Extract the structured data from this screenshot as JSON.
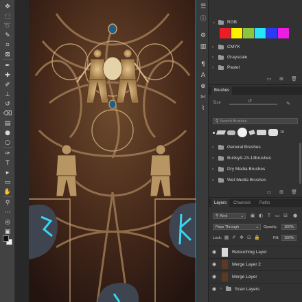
{
  "toolbar": {
    "tools": [
      {
        "icon": "move-icon",
        "glyph": "✥"
      },
      {
        "icon": "marquee-icon",
        "glyph": "⬚"
      },
      {
        "icon": "lasso-icon",
        "glyph": "➰"
      },
      {
        "icon": "quick-select-icon",
        "glyph": "✎"
      },
      {
        "icon": "crop-icon",
        "glyph": "⌗"
      },
      {
        "icon": "frame-icon",
        "glyph": "⊠"
      },
      {
        "icon": "eyedropper-icon",
        "glyph": "✒"
      },
      {
        "icon": "spot-heal-icon",
        "glyph": "✚"
      },
      {
        "icon": "brush-icon",
        "glyph": "✐"
      },
      {
        "icon": "clone-stamp-icon",
        "glyph": "⊥"
      },
      {
        "icon": "history-brush-icon",
        "glyph": "↺"
      },
      {
        "icon": "eraser-icon",
        "glyph": "⌫"
      },
      {
        "icon": "gradient-icon",
        "glyph": "▤"
      },
      {
        "icon": "blur-icon",
        "glyph": "●"
      },
      {
        "icon": "dodge-icon",
        "glyph": "○"
      },
      {
        "icon": "pen-icon",
        "glyph": "✑"
      },
      {
        "icon": "type-icon",
        "glyph": "T"
      },
      {
        "icon": "path-select-icon",
        "glyph": "▸"
      },
      {
        "icon": "rectangle-icon",
        "glyph": "▭"
      },
      {
        "icon": "hand-icon",
        "glyph": "✋"
      },
      {
        "icon": "zoom-icon",
        "glyph": "⚲"
      },
      {
        "icon": "more-tools-icon",
        "glyph": "···"
      },
      {
        "icon": "quick-mask-icon",
        "glyph": "◎"
      },
      {
        "icon": "screen-mode-icon",
        "glyph": "▣"
      }
    ],
    "foreground_color": "#111111",
    "background_color": "#f2f2f2"
  },
  "dock": {
    "icons": [
      {
        "icon": "adjustments-icon",
        "glyph": "☰"
      },
      {
        "icon": "info-icon",
        "glyph": "ⓘ"
      },
      {
        "icon": "properties-icon",
        "glyph": "⚙"
      },
      {
        "icon": "libraries-icon",
        "glyph": "▥"
      },
      {
        "icon": "paragraph-icon",
        "glyph": "¶"
      },
      {
        "icon": "character-icon",
        "glyph": "A"
      },
      {
        "icon": "clone-source-icon",
        "glyph": "⊕"
      },
      {
        "icon": "paths-icon",
        "glyph": "✄"
      },
      {
        "icon": "brush-settings-icon",
        "glyph": "⌇"
      }
    ]
  },
  "swatches": {
    "groups": [
      {
        "label": "RGB",
        "expanded": true
      },
      {
        "label": "CMYK",
        "expanded": false
      },
      {
        "label": "Grayscale",
        "expanded": false
      },
      {
        "label": "Pastel",
        "expanded": false
      }
    ],
    "rgb_colors": [
      "#ee1c24",
      "#fdf100",
      "#8cc63f",
      "#29e3f7",
      "#2b3bf5",
      "#ed1ee4"
    ]
  },
  "brushes": {
    "title": "Brushes",
    "size_label": "Size",
    "search_placeholder": "Search Brushes",
    "preset_size": "15",
    "groups": [
      {
        "label": "General Brushes"
      },
      {
        "label": "Burley9-23-13brushes"
      },
      {
        "label": "Dry Media Brushes"
      },
      {
        "label": "Wet Media Brushes"
      }
    ]
  },
  "layers": {
    "tabs": [
      "Layers",
      "Channels",
      "Paths"
    ],
    "kind_label": "Kind",
    "blend_mode": "Pass Through",
    "opacity_label": "Opacity:",
    "opacity_value": "100%",
    "lock_label": "Lock:",
    "fill_label": "Fill:",
    "fill_value": "100%",
    "items": [
      {
        "name": "Retouching Layer",
        "thumb": "#d9d9d9"
      },
      {
        "name": "Merge Layer 2",
        "thumb": "#5a3a24"
      },
      {
        "name": "Merge Layer",
        "thumb": "#5a3a24"
      },
      {
        "name": "Scan Layers",
        "thumb": "folder"
      }
    ]
  }
}
